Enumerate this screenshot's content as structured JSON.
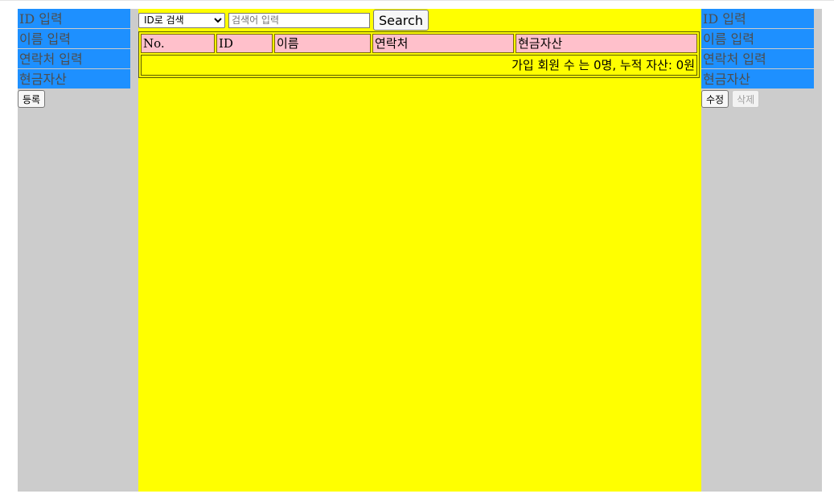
{
  "register_form": {
    "id_placeholder": "ID 입력",
    "name_placeholder": "이름 입력",
    "contact_placeholder": "연락처 입력",
    "cash_placeholder": "현금자산",
    "register_label": "등록"
  },
  "search": {
    "selected_option": "ID로 검색",
    "placeholder": "검색어 입력",
    "button_label": "Search"
  },
  "table": {
    "headers": [
      "No.",
      "ID",
      "이름",
      "연락처",
      "현금자산"
    ],
    "summary": "가입 회원 수 는 0명, 누적 자산: 0원"
  },
  "edit_form": {
    "id_placeholder": "ID 입력",
    "name_placeholder": "이름 입력",
    "contact_placeholder": "연락처 입력",
    "cash_placeholder": "현금자산",
    "edit_label": "수정",
    "delete_label": "삭제"
  },
  "colors": {
    "input_bg": "#1e90ff",
    "side_panel": "#cccccc",
    "center_panel": "#ffff00",
    "header_cell": "#ffc0cb"
  }
}
